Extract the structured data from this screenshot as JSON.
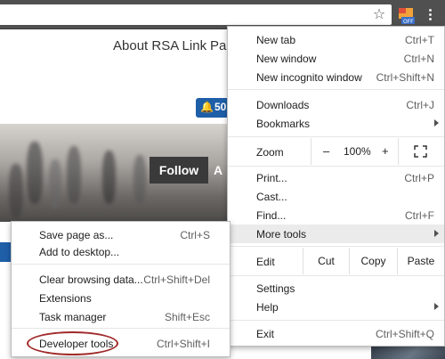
{
  "toolbar": {
    "star_icon": "star-icon",
    "extension_badge": "OFF",
    "menu_icon": "three-dots-icon"
  },
  "page": {
    "nav_links": [
      "About RSA Link",
      "Par"
    ],
    "notification_count": "50",
    "follow_label": "Follow",
    "follow_trailing": "A"
  },
  "chrome_menu": {
    "items": [
      {
        "label": "New tab",
        "shortcut": "Ctrl+T"
      },
      {
        "label": "New window",
        "shortcut": "Ctrl+N"
      },
      {
        "label": "New incognito window",
        "shortcut": "Ctrl+Shift+N"
      },
      {
        "label": "Downloads",
        "shortcut": "Ctrl+J"
      },
      {
        "label": "Bookmarks",
        "shortcut": ""
      },
      {
        "label": "Print...",
        "shortcut": "Ctrl+P"
      },
      {
        "label": "Cast...",
        "shortcut": ""
      },
      {
        "label": "Find...",
        "shortcut": "Ctrl+F"
      },
      {
        "label": "More tools",
        "shortcut": ""
      },
      {
        "label": "Settings",
        "shortcut": ""
      },
      {
        "label": "Help",
        "shortcut": ""
      },
      {
        "label": "Exit",
        "shortcut": "Ctrl+Shift+Q"
      }
    ],
    "zoom": {
      "label": "Zoom",
      "minus": "–",
      "value": "100%",
      "plus": "+"
    },
    "edit": {
      "label": "Edit",
      "cut": "Cut",
      "copy": "Copy",
      "paste": "Paste"
    }
  },
  "more_tools_menu": {
    "items": [
      {
        "label": "Save page as...",
        "shortcut": "Ctrl+S"
      },
      {
        "label": "Add to desktop...",
        "shortcut": ""
      },
      {
        "label": "Clear browsing data...",
        "shortcut": "Ctrl+Shift+Del"
      },
      {
        "label": "Extensions",
        "shortcut": ""
      },
      {
        "label": "Task manager",
        "shortcut": "Shift+Esc"
      },
      {
        "label": "Developer tools",
        "shortcut": "Ctrl+Shift+I"
      }
    ]
  },
  "colors": {
    "toolbar": "#505050",
    "badge_blue": "#1f5fa8",
    "highlight_ring": "#a12a2a",
    "menu_hover": "#ebebeb"
  }
}
